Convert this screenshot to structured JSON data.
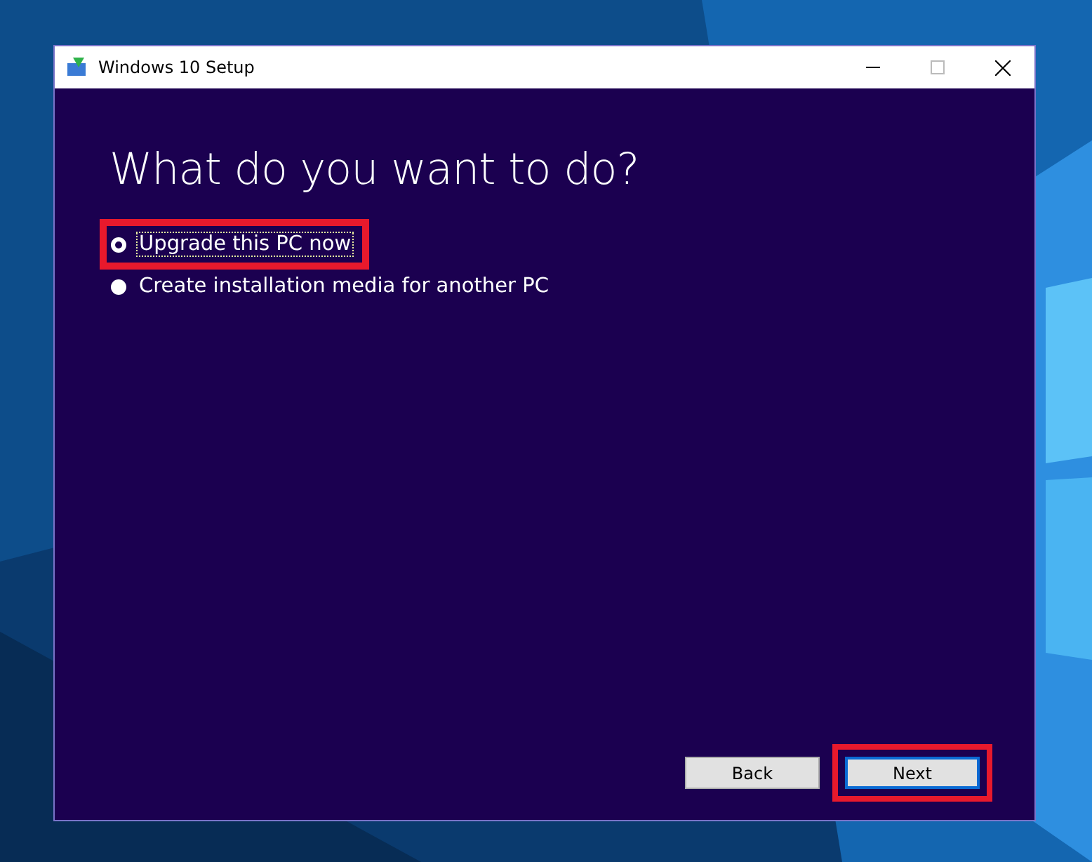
{
  "window": {
    "title": "Windows 10 Setup"
  },
  "heading": "What do you want to do?",
  "options": [
    {
      "label": "Upgrade this PC now",
      "selected": true,
      "focused": true,
      "highlighted": true
    },
    {
      "label": "Create installation media for another PC",
      "selected": false,
      "focused": false,
      "highlighted": false
    }
  ],
  "buttons": [
    {
      "label": "Back",
      "default": false,
      "highlighted": false
    },
    {
      "label": "Next",
      "default": true,
      "highlighted": true
    }
  ]
}
